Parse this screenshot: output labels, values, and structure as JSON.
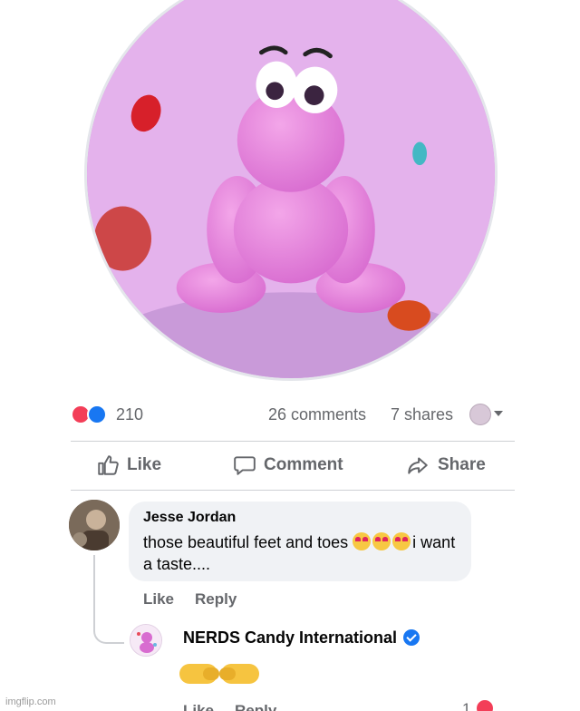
{
  "post": {
    "reaction_count": "210",
    "comments": "26 comments",
    "shares": "7 shares"
  },
  "actions": {
    "like": "Like",
    "comment": "Comment",
    "share": "Share"
  },
  "comments": [
    {
      "author": "Jesse Jordan",
      "text_before": "those beautiful feet and toes ",
      "emoji": "smiling-face-with-heart-eyes x3",
      "text_after": "i want a taste....",
      "like": "Like",
      "reply": "Reply"
    },
    {
      "author": "NERDS Candy International",
      "content": "pointing-hands emoji",
      "like": "Like",
      "reply": "Reply",
      "reaction_count": "1"
    }
  ],
  "watermark": "imgflip.com",
  "colors": {
    "like_blue": "#1877f2",
    "heart_red": "#f33e58",
    "muted_text": "#65676b",
    "bubble_bg": "#f0f2f5",
    "avatar_pink": "#d9a0e4"
  }
}
